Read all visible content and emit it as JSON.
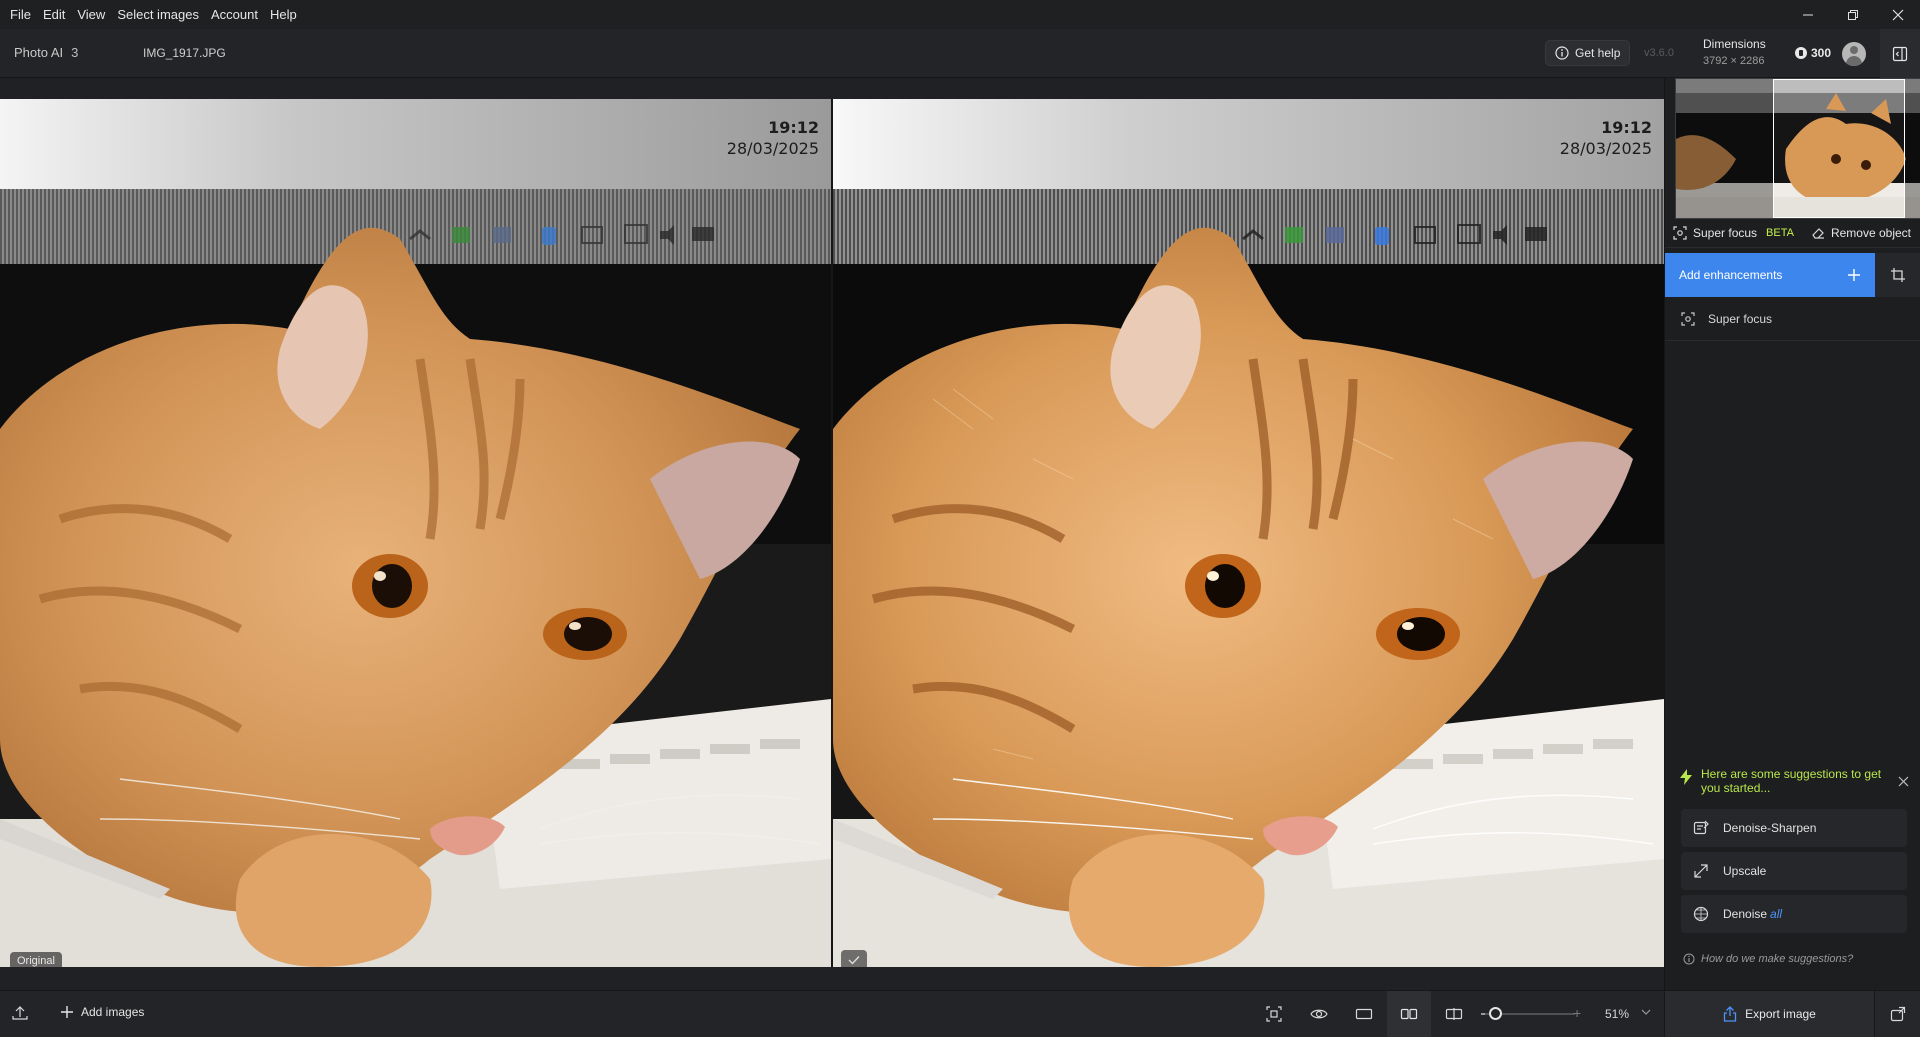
{
  "menu": [
    "File",
    "Edit",
    "View",
    "Select images",
    "Account",
    "Help"
  ],
  "header": {
    "app_name": "Photo AI",
    "image_count": "3",
    "file_name": "IMG_1917.JPG",
    "get_help": "Get help",
    "version": "v3.6.0",
    "dimensions_label": "Dimensions",
    "dimensions_value": "3792 × 2286",
    "credits": "300"
  },
  "canvas": {
    "left_tag": "Original",
    "clock_time": "19:12",
    "clock_date": "28/03/2025"
  },
  "sidebar": {
    "super_focus_label": "Super focus",
    "beta_label": "BETA",
    "remove_object_label": "Remove object",
    "add_enhancements_label": "Add enhancements",
    "enhancement_item": "Super focus",
    "suggestions_heading": "Here are some suggestions to get you started...",
    "suggestions": [
      {
        "label": "Denoise-Sharpen"
      },
      {
        "label": "Upscale"
      },
      {
        "label": "Denoise",
        "suffix": "all"
      }
    ],
    "how_text": "How do we make suggestions?"
  },
  "bottombar": {
    "add_images_label": "Add images",
    "zoom_value": "51%",
    "zoom_level": 0.12,
    "export_label": "Export image"
  },
  "colors": {
    "accent": "#3c86ee",
    "beta": "#c6f44a",
    "suggestion": "#b8e64c"
  }
}
